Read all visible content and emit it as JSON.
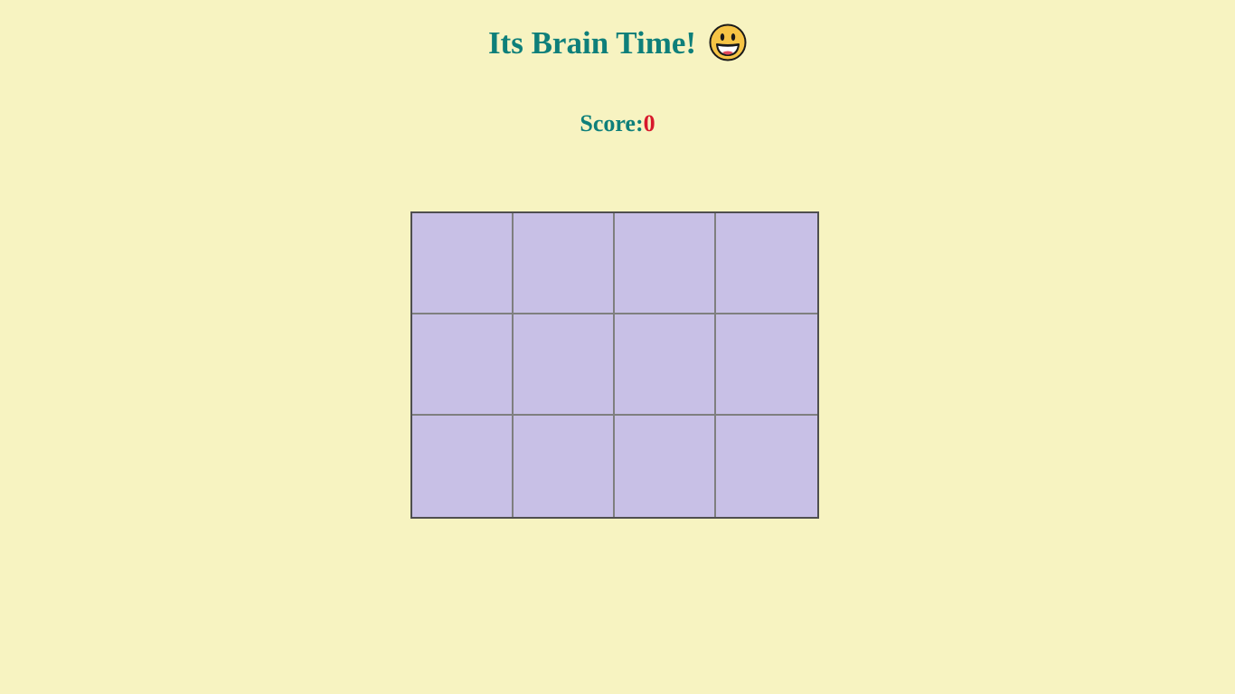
{
  "header": {
    "title": "Its Brain Time!",
    "emoji_icon": "grinning-face-icon"
  },
  "score": {
    "label": "Score:",
    "value": "0"
  },
  "board": {
    "rows": 3,
    "columns": 4,
    "cells": [
      "",
      "",
      "",
      "",
      "",
      "",
      "",
      "",
      "",
      "",
      "",
      ""
    ]
  },
  "colors": {
    "background": "#f7f3c1",
    "title": "#0e7f7a",
    "score_value": "#d7192c",
    "cell_back": "#c8c0e6",
    "grid_lines": "#7f7f7f",
    "board_border": "#4f4f4f"
  }
}
